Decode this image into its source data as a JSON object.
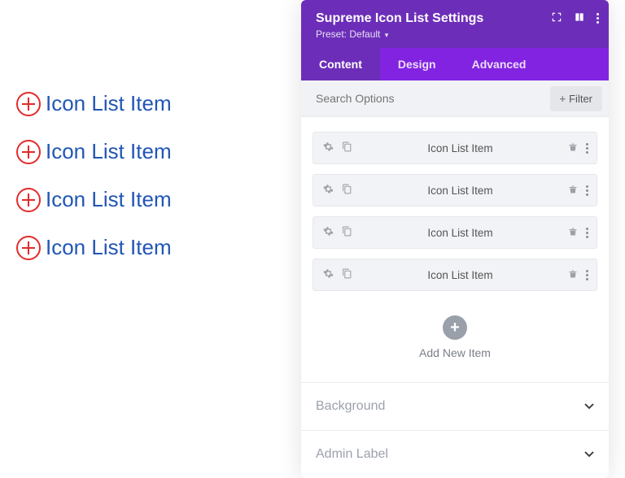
{
  "preview": {
    "items": [
      {
        "label": "Icon List Item"
      },
      {
        "label": "Icon List Item"
      },
      {
        "label": "Icon List Item"
      },
      {
        "label": "Icon List Item"
      }
    ]
  },
  "panel": {
    "title": "Supreme Icon List Settings",
    "preset_label": "Preset:",
    "preset_value": "Default"
  },
  "tabs": {
    "content": "Content",
    "design": "Design",
    "advanced": "Advanced"
  },
  "search": {
    "placeholder": "Search Options",
    "filter_label": "Filter"
  },
  "list": {
    "items": [
      {
        "label": "Icon List Item"
      },
      {
        "label": "Icon List Item"
      },
      {
        "label": "Icon List Item"
      },
      {
        "label": "Icon List Item"
      }
    ],
    "add_label": "Add New Item"
  },
  "sections": {
    "background": "Background",
    "admin_label": "Admin Label"
  }
}
